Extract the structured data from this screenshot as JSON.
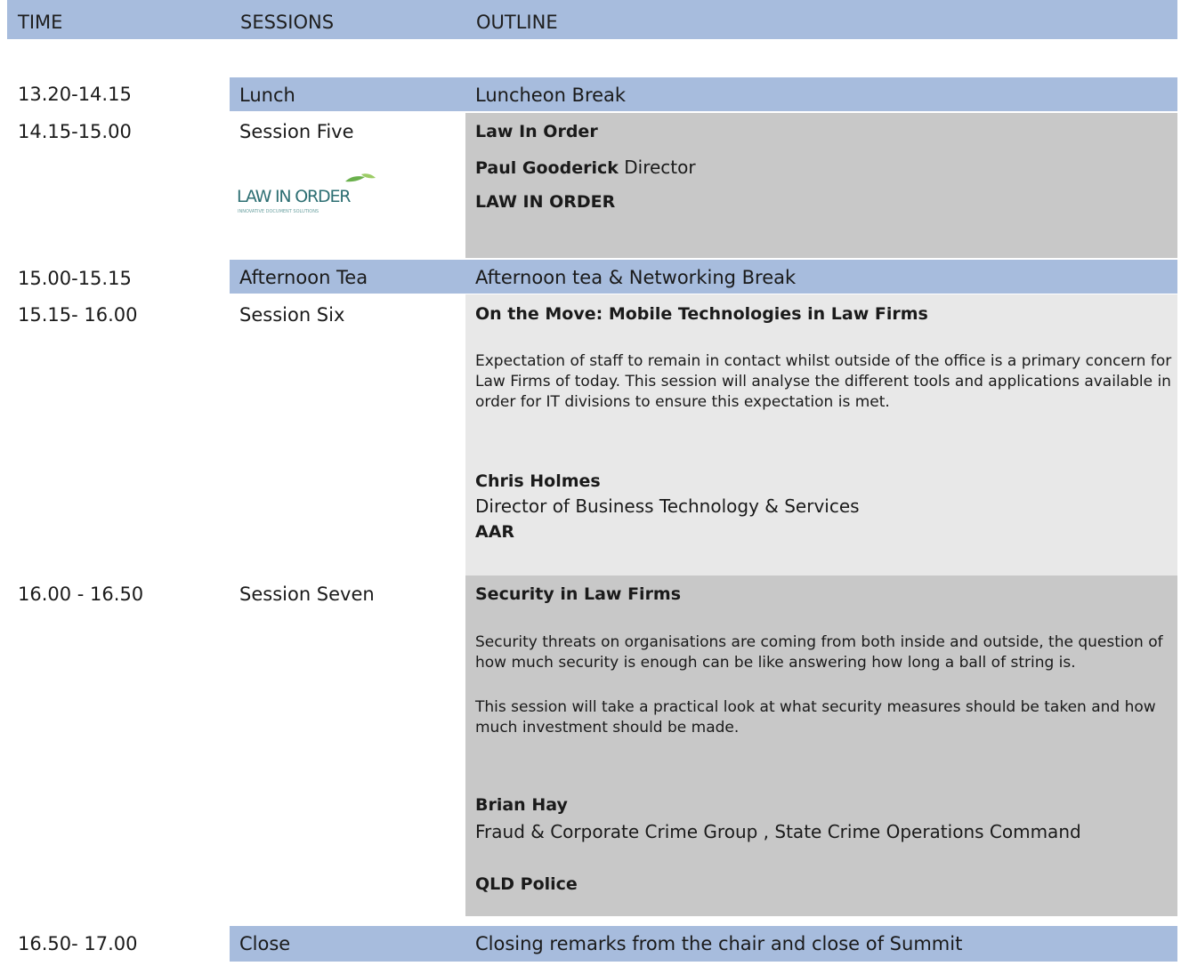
{
  "header": {
    "time": "TIME",
    "sessions": "SESSIONS",
    "outline": "OUTLINE"
  },
  "rows": {
    "lunch": {
      "time": "13.20-14.15",
      "session": "Lunch",
      "outline": "Luncheon Break"
    },
    "five": {
      "time": "14.15-15.00",
      "session": "Session Five",
      "title": "Law In Order",
      "speaker": "Paul Gooderick",
      "role": " Director",
      "org": "LAW IN ORDER",
      "logo_text": "LAW IN ORDER",
      "logo_tagline": "INNOVATIVE DOCUMENT SOLUTIONS"
    },
    "tea": {
      "time": "15.00-15.15",
      "session": "Afternoon Tea",
      "outline": "Afternoon tea & Networking Break"
    },
    "six": {
      "time": "15.15- 16.00",
      "session": "Session Six",
      "title": "On the Move: Mobile Technologies in Law Firms",
      "desc": "Expectation of staff to remain in contact whilst outside of the office is a primary concern for Law Firms of today. This session will analyse the different tools and applications available in order for IT divisions to ensure this expectation is met.",
      "speaker": "Chris Holmes",
      "role": "Director of Business Technology & Services",
      "org": "AAR"
    },
    "seven": {
      "time": "16.00 - 16.50",
      "session": "Session Seven",
      "title": "Security in Law Firms",
      "desc1": "Security threats on organisations are coming from both inside and outside, the question of how much security is enough can be like answering how long a ball of string is.",
      "desc2": "This session will take a practical look at what security measures should be taken and how much investment should be made.",
      "speaker": "Brian Hay",
      "role": "Fraud & Corporate Crime Group , State Crime Operations Command",
      "org": "QLD Police"
    },
    "close": {
      "time": "16.50- 17.00",
      "session": "Close",
      "outline": "Closing remarks from the chair and close of Summit"
    }
  }
}
